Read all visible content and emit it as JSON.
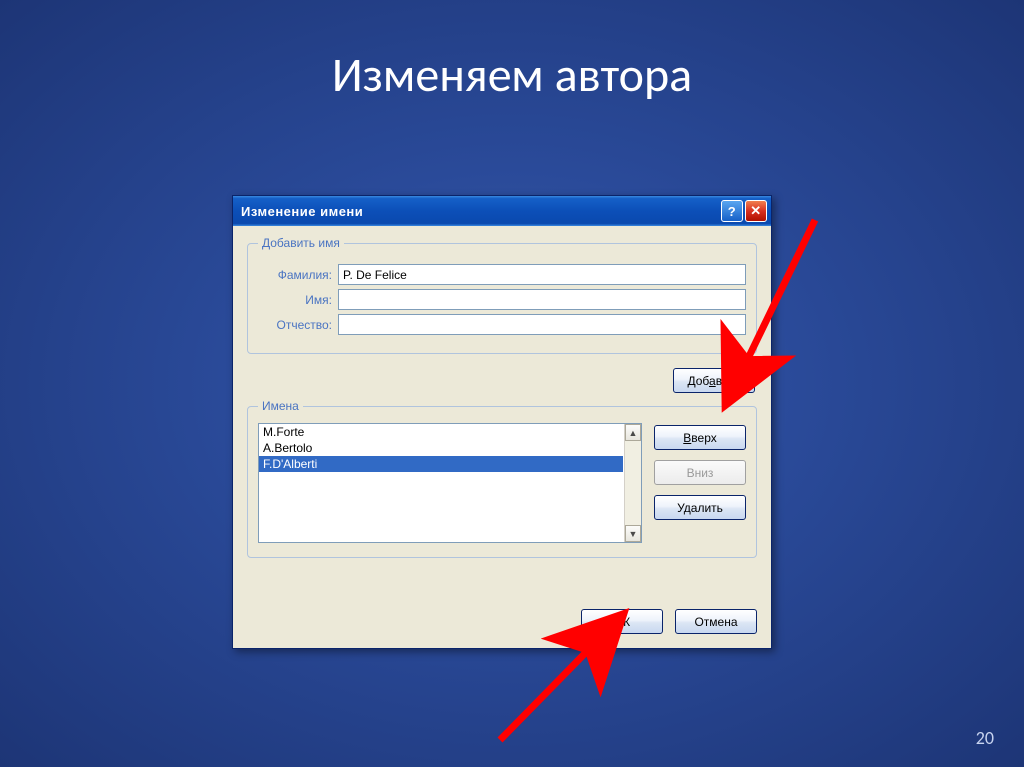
{
  "slide": {
    "title": "Изменяем автора",
    "number": "20"
  },
  "dialog": {
    "title": "Изменение имени",
    "fieldsets": {
      "add": {
        "legend": "Добавить имя",
        "labels": {
          "surname": "Фамилия:",
          "firstname": "Имя:",
          "patronymic": "Отчество:"
        },
        "values": {
          "surname": "P. De Felice",
          "firstname": "",
          "patronymic": ""
        }
      },
      "names": {
        "legend": "Имена",
        "items": [
          {
            "text": "M.Forte",
            "selected": false
          },
          {
            "text": "A.Bertolo",
            "selected": false
          },
          {
            "text": "F.D'Alberti",
            "selected": true
          }
        ]
      }
    },
    "buttons": {
      "add": "Добавить",
      "up": "Вверх",
      "down": "Вниз",
      "delete": "Удалить",
      "ok": "ОК",
      "cancel": "Отмена"
    }
  }
}
